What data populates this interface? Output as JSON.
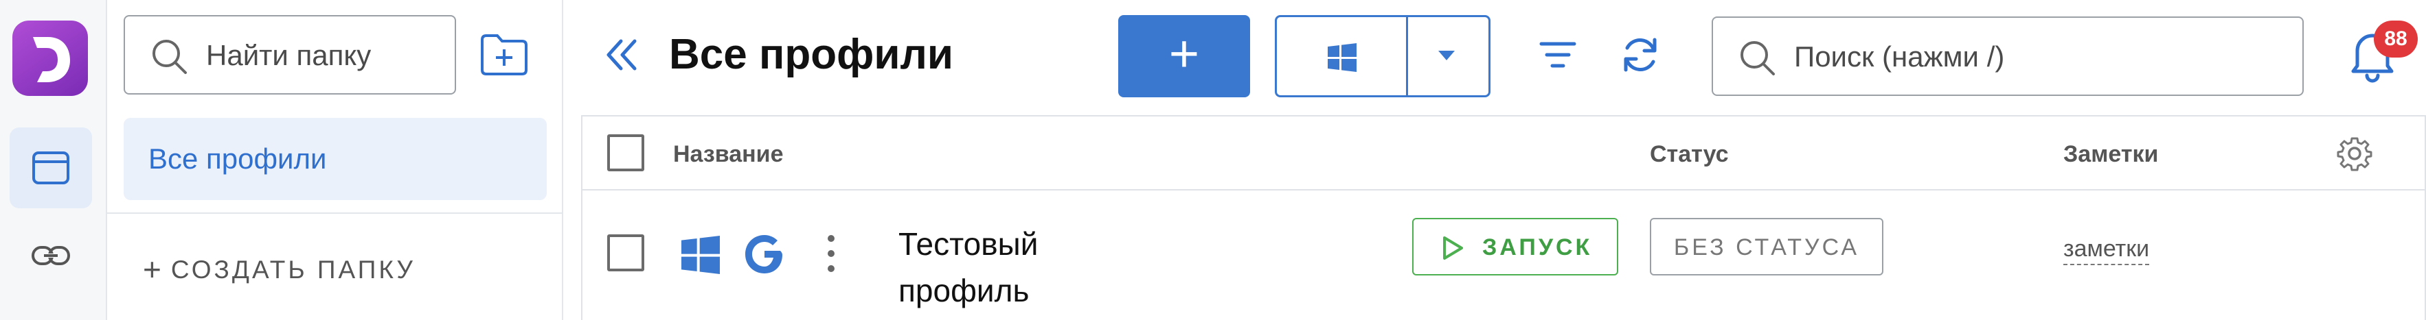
{
  "rail": {
    "logo_letter": "D",
    "items": [
      {
        "icon": "browser-window-icon",
        "active": true
      },
      {
        "icon": "link-icon",
        "active": false
      }
    ]
  },
  "folders": {
    "search_placeholder": "Найти папку",
    "items": [
      {
        "label": "Все профили",
        "active": true
      }
    ],
    "create_label": "СОЗДАТЬ ПАПКУ",
    "create_plus": "+"
  },
  "header": {
    "title": "Все профили",
    "add_label": "+",
    "os_selected_icon": "windows-icon",
    "search_placeholder": "Поиск (нажми /)",
    "notifications_count": "88"
  },
  "table": {
    "columns": {
      "name": "Название",
      "status": "Статус",
      "notes": "Заметки"
    },
    "rows": [
      {
        "os": "windows-icon",
        "browser": "google-icon",
        "name": "Тестовый профиль",
        "launch_label": "ЗАПУСК",
        "status": "БЕЗ СТАТУСА",
        "notes": "заметки"
      }
    ]
  },
  "colors": {
    "accent": "#3a78d0",
    "logo": "#9b3fcc",
    "launch": "#4caf50",
    "badge": "#e0383b",
    "active_bg": "#ebf1fa"
  }
}
